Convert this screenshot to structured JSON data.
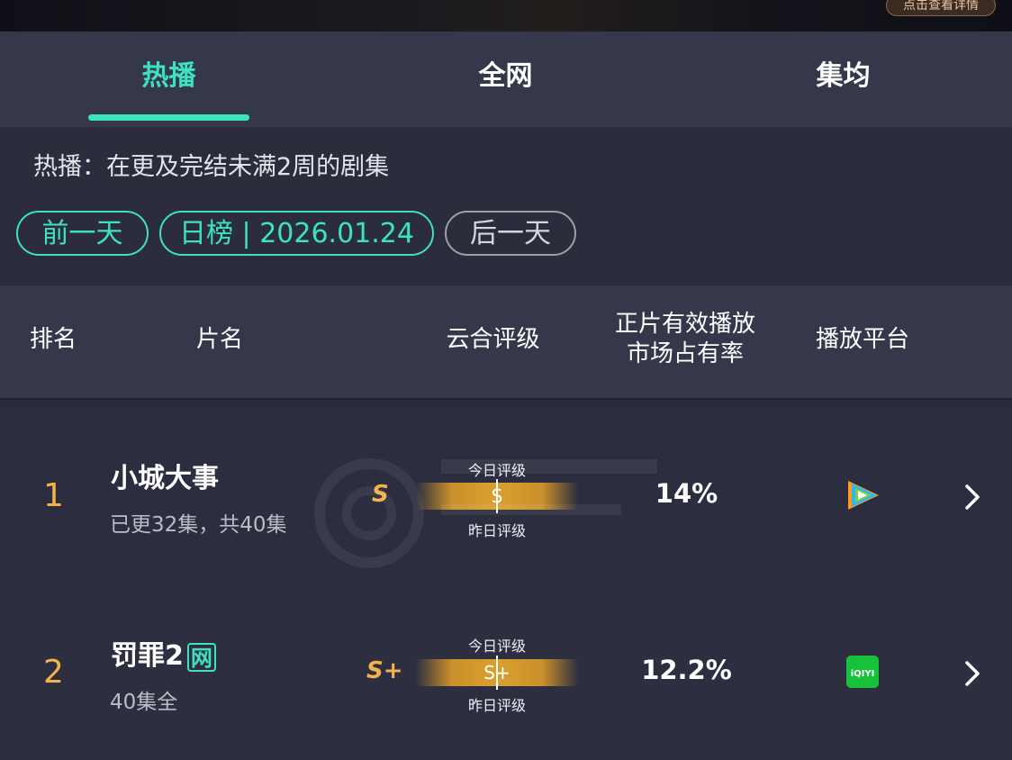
{
  "banner": {
    "button_label": "点击查看详情"
  },
  "tabs": [
    {
      "label": "热播"
    },
    {
      "label": "全网"
    },
    {
      "label": "集均"
    }
  ],
  "description": "热播：在更及完结未满2周的剧集",
  "date_nav": {
    "prev": "前一天",
    "current": "日榜 | 2026.01.24",
    "next": "后一天"
  },
  "table_headers": {
    "rank": "排名",
    "title": "片名",
    "rating": "云合评级",
    "share_line1": "正片有效播放",
    "share_line2": "市场占有率",
    "platform": "播放平台"
  },
  "gauge_labels": {
    "today": "今日评级",
    "yesterday": "昨日评级"
  },
  "rows": [
    {
      "rank": "1",
      "title": "小城大事",
      "badge": "",
      "subtitle": "已更32集，共40集",
      "grade": "S",
      "gauge_grade": "S",
      "share": "14%",
      "platform_icon": "tencent-video-icon"
    },
    {
      "rank": "2",
      "title": "罚罪2",
      "badge": "网",
      "subtitle": "40集全",
      "grade": "S+",
      "gauge_grade": "S+",
      "share": "12.2%",
      "platform_icon": "iqiyi-icon"
    }
  ],
  "colors": {
    "accent": "#3de2c0",
    "rank": "#f3b24a",
    "header_bg": "#35384b",
    "body_bg": "#2b2d3d"
  }
}
